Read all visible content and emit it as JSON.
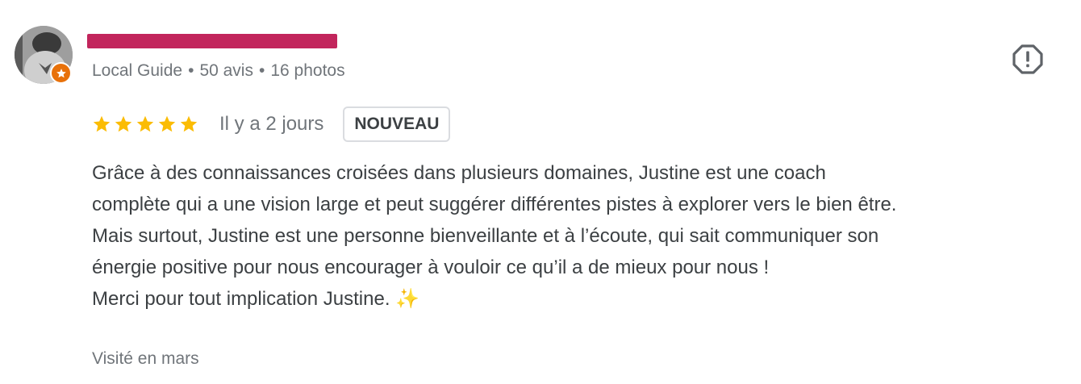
{
  "review": {
    "author": {
      "name": "",
      "avatar_icon": "user-avatar",
      "badge_icon": "local-guide-star-icon",
      "badge_color": "#e8710a",
      "guide_label": "Local Guide",
      "separator": "•",
      "reviews_count": "50 avis",
      "photos_count": "16 photos"
    },
    "report_icon": "report-octagon-icon",
    "rating": {
      "stars": 5,
      "max": 5,
      "star_color": "#fbbc04"
    },
    "relative_date": "Il y a 2 jours",
    "badge_label": "NOUVEAU",
    "text_lines": [
      "Grâce à des connaissances croisées dans plusieurs domaines, Justine est une coach",
      "complète qui a une vision large et peut suggérer différentes pistes à explorer vers le bien être.",
      "Mais surtout, Justine est une personne bienveillante et à l’écoute, qui sait communiquer son",
      "énergie positive pour nous encourager à vouloir ce qu’il a de mieux pour nous !",
      "Merci pour tout implication Justine."
    ],
    "emoji": "✨",
    "visited": "Visité en mars",
    "colors": {
      "redaction": "#c2255c",
      "link": "#1a73e8",
      "secondary_text": "#70757a"
    }
  }
}
